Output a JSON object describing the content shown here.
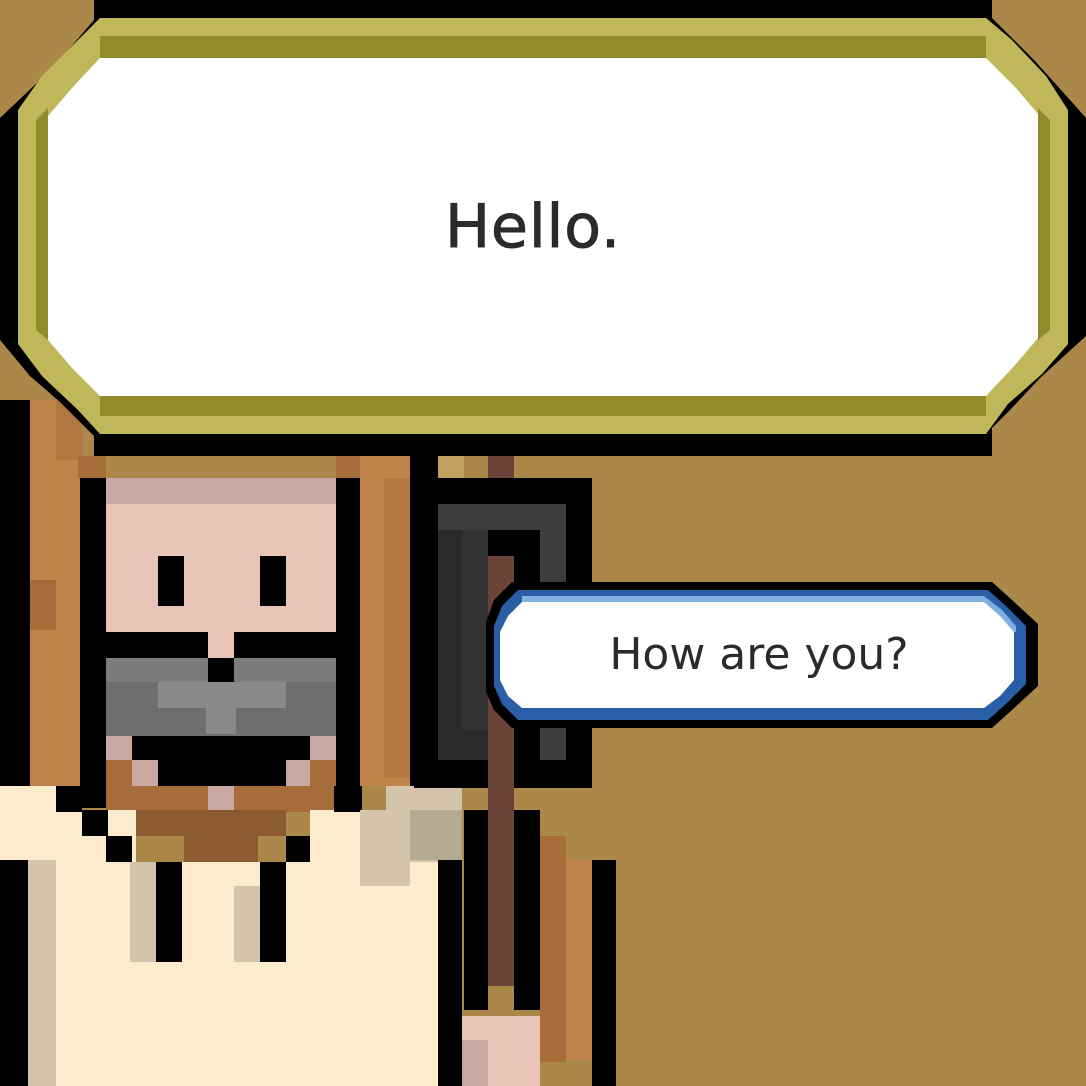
{
  "dialogue": {
    "speech": "Hello.",
    "frame_colors": {
      "outer": "#000000",
      "trim": "#c0b75a",
      "trim_shade": "#928b2c",
      "fill": "#ffffff"
    }
  },
  "reply_options": [
    {
      "label": "How are you?",
      "border": "#2a5fa8",
      "shine": "#7fb0e0"
    }
  ],
  "character": {
    "name_icon": "bearded-old-man-icon",
    "palette": {
      "skin": "#e8c4b8",
      "skin_top": "#c8a8a0",
      "hair": "#c0844a",
      "hair_dark": "#a66d3a",
      "beard": "#6e6e6e",
      "beard_light": "#8a8a8a",
      "robe": "#fdebce",
      "robe_shade": "#d3c4ab",
      "belt": "#8c5a30",
      "staff": "#6b4439",
      "staff_head": "#3c3c3c"
    }
  },
  "background_color": "#ab874a"
}
